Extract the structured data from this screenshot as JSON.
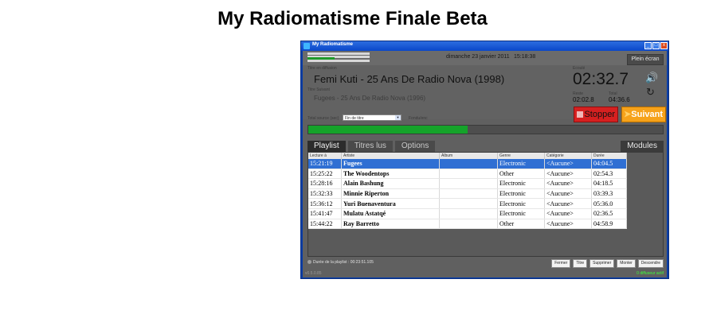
{
  "page": {
    "title": "My Radiomatisme Finale Beta"
  },
  "window": {
    "title": "My Radiomatisme",
    "controls": {
      "minimize": "_",
      "maximize": "□",
      "close": "x"
    }
  },
  "header": {
    "date": "dimanche 23 janvier 2011",
    "time": "15:18:38",
    "fullscreen_label": "Plein écran",
    "audio_levels": [
      0.98,
      0.98,
      0.42,
      0.98
    ]
  },
  "now_playing": {
    "label": "Titre en diffusion",
    "title": "Femi Kuti - 25 Ans De Radio Nova (1998)",
    "elapsed_label": "Ecoulé",
    "elapsed": "02:32.7"
  },
  "next": {
    "label": "Titre Suivant",
    "title": "Fugees - 25 Ans De Radio Nova (1996)"
  },
  "times": {
    "remaining_label": "Reste",
    "remaining": "02:02.8",
    "total_label": "Total",
    "total": "04:36.6"
  },
  "controls": {
    "select_label": "Total source (sec)",
    "select_value": "Fin de titre",
    "fade_label": "Fondu/enc",
    "stop_label": "Stopper",
    "next_label": "Suivant",
    "progress": 0.45
  },
  "tabs": [
    {
      "label": "Playlist"
    },
    {
      "label": "Titres lus"
    },
    {
      "label": "Options"
    }
  ],
  "modules_label": "Modules",
  "playlist": {
    "columns": [
      "Lecture à",
      "Artiste",
      "Album",
      "Genre",
      "Catégorie",
      "Durée"
    ],
    "rows": [
      {
        "time": "15:21:19",
        "artist": "Fugees",
        "album": "",
        "genre": "Electronic",
        "category": "<Aucune>",
        "duration": "04:04.5"
      },
      {
        "time": "15:25:22",
        "artist": "The Woodentops",
        "album": "",
        "genre": "Other",
        "category": "<Aucune>",
        "duration": "02:54.3"
      },
      {
        "time": "15:28:16",
        "artist": "Alain Bashung",
        "album": "",
        "genre": "Electronic",
        "category": "<Aucune>",
        "duration": "04:18.5"
      },
      {
        "time": "15:32:33",
        "artist": "Minnie Riperton",
        "album": "",
        "genre": "Electronic",
        "category": "<Aucune>",
        "duration": "03:39.3"
      },
      {
        "time": "15:36:12",
        "artist": "Yuri Buenaventura",
        "album": "",
        "genre": "Electronic",
        "category": "<Aucune>",
        "duration": "05:36.0"
      },
      {
        "time": "15:41:47",
        "artist": "Mulatu Astatqé",
        "album": "",
        "genre": "Electronic",
        "category": "<Aucune>",
        "duration": "02:36.5"
      },
      {
        "time": "15:44:22",
        "artist": "Ray Barretto",
        "album": "",
        "genre": "Other",
        "category": "<Aucune>",
        "duration": "04:58.9"
      }
    ]
  },
  "bottom": {
    "duration_text": "Durée de la playlist : 00:23:51.105",
    "buttons": [
      "Fermer",
      "Titre",
      "Supprimer",
      "Monter",
      "Descendre"
    ]
  },
  "status": {
    "version": "v0.5.0.85",
    "diffuser": "0 diffuseur actif"
  },
  "colors": {
    "accent": "#2f6fd3",
    "stop": "#d62020",
    "next": "#f6a21a",
    "progress": "#15a32a",
    "titlebar": "#0a47c9"
  }
}
